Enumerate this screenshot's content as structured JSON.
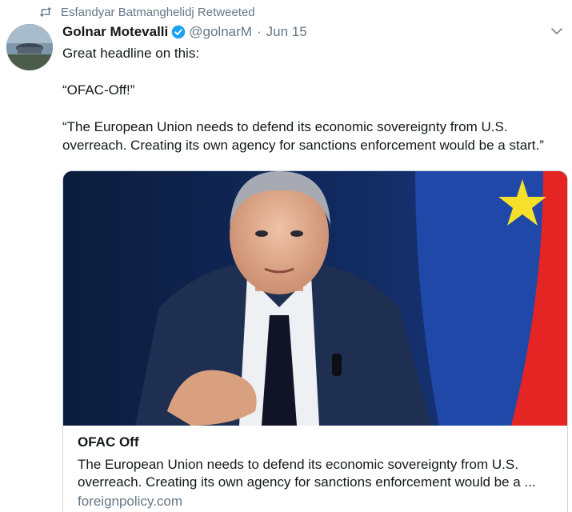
{
  "retweet": {
    "label": "Esfandyar Batmanghelidj Retweeted"
  },
  "tweet": {
    "display_name": "Golnar Motevalli",
    "handle": "@golnarM",
    "separator": "·",
    "date": "Jun 15",
    "paragraphs": [
      "Great headline on this:",
      "“OFAC-Off!”",
      "“The European Union needs to defend its economic sovereignty from U.S. overreach. Creating its own agency for sanctions enforcement would be a start.”"
    ]
  },
  "card": {
    "title": "OFAC Off",
    "description": "The European Union needs to defend its economic sovereignty from U.S. overreach. Creating its own agency for sanctions enforcement would be a ...",
    "domain": "foreignpolicy.com"
  },
  "icons": {
    "retweet": "retweet-icon",
    "verified": "verified-badge-icon",
    "menu": "chevron-down-icon"
  },
  "colors": {
    "text": "#14171a",
    "secondary": "#657786",
    "verified": "#1da1f2",
    "border": "#ccd6dd"
  }
}
